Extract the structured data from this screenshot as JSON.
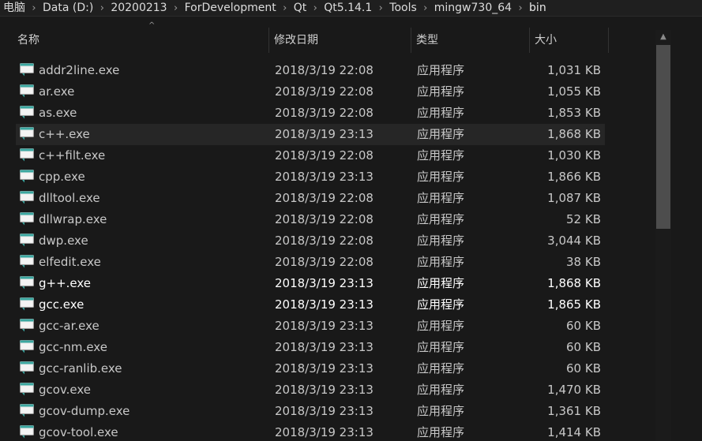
{
  "breadcrumb": [
    {
      "label": "电脑"
    },
    {
      "label": "Data (D:)"
    },
    {
      "label": "20200213"
    },
    {
      "label": "ForDevelopment"
    },
    {
      "label": "Qt"
    },
    {
      "label": "Qt5.14.1"
    },
    {
      "label": "Tools"
    },
    {
      "label": "mingw730_64"
    },
    {
      "label": "bin"
    }
  ],
  "columns": {
    "name": "名称",
    "date": "修改日期",
    "type": "类型",
    "size": "大小"
  },
  "sort_indicator": "^",
  "files": [
    {
      "name": "addr2line.exe",
      "date": "2018/3/19 22:08",
      "type": "应用程序",
      "size": "1,031 KB"
    },
    {
      "name": "ar.exe",
      "date": "2018/3/19 22:08",
      "type": "应用程序",
      "size": "1,055 KB"
    },
    {
      "name": "as.exe",
      "date": "2018/3/19 22:08",
      "type": "应用程序",
      "size": "1,853 KB"
    },
    {
      "name": "c++.exe",
      "date": "2018/3/19 23:13",
      "type": "应用程序",
      "size": "1,868 KB"
    },
    {
      "name": "c++filt.exe",
      "date": "2018/3/19 22:08",
      "type": "应用程序",
      "size": "1,030 KB"
    },
    {
      "name": "cpp.exe",
      "date": "2018/3/19 23:13",
      "type": "应用程序",
      "size": "1,866 KB"
    },
    {
      "name": "dlltool.exe",
      "date": "2018/3/19 22:08",
      "type": "应用程序",
      "size": "1,087 KB"
    },
    {
      "name": "dllwrap.exe",
      "date": "2018/3/19 22:08",
      "type": "应用程序",
      "size": "52 KB"
    },
    {
      "name": "dwp.exe",
      "date": "2018/3/19 22:08",
      "type": "应用程序",
      "size": "3,044 KB"
    },
    {
      "name": "elfedit.exe",
      "date": "2018/3/19 22:08",
      "type": "应用程序",
      "size": "38 KB"
    },
    {
      "name": "g++.exe",
      "date": "2018/3/19 23:13",
      "type": "应用程序",
      "size": "1,868 KB"
    },
    {
      "name": "gcc.exe",
      "date": "2018/3/19 23:13",
      "type": "应用程序",
      "size": "1,865 KB"
    },
    {
      "name": "gcc-ar.exe",
      "date": "2018/3/19 23:13",
      "type": "应用程序",
      "size": "60 KB"
    },
    {
      "name": "gcc-nm.exe",
      "date": "2018/3/19 23:13",
      "type": "应用程序",
      "size": "60 KB"
    },
    {
      "name": "gcc-ranlib.exe",
      "date": "2018/3/19 23:13",
      "type": "应用程序",
      "size": "60 KB"
    },
    {
      "name": "gcov.exe",
      "date": "2018/3/19 23:13",
      "type": "应用程序",
      "size": "1,470 KB"
    },
    {
      "name": "gcov-dump.exe",
      "date": "2018/3/19 23:13",
      "type": "应用程序",
      "size": "1,361 KB"
    },
    {
      "name": "gcov-tool.exe",
      "date": "2018/3/19 23:13",
      "type": "应用程序",
      "size": "1,414 KB"
    }
  ],
  "icons": {
    "breadcrumb_separator": "chevron-right-icon",
    "file": "exe-file-icon",
    "scroll_up": "scroll-up-arrow-icon"
  },
  "colors": {
    "background": "#191919",
    "icon_teal": "#3aa7a0",
    "hover_row": "#262626"
  }
}
